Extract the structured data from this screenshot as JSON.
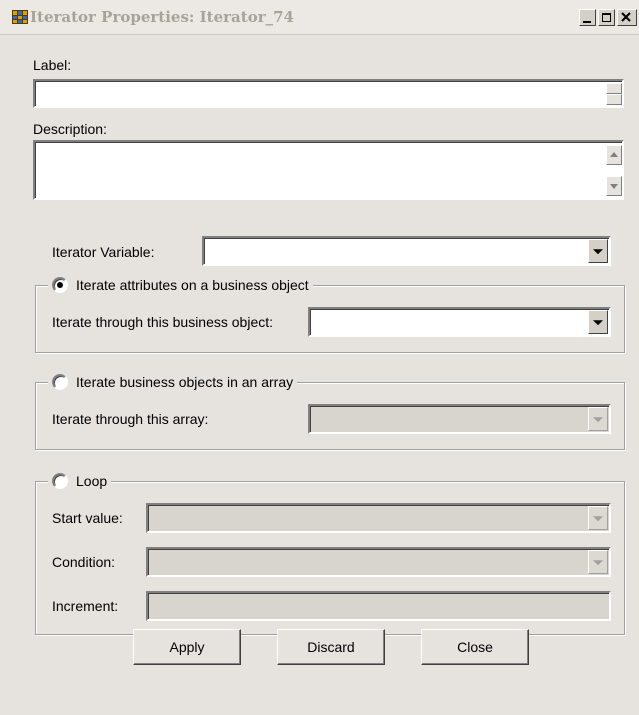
{
  "window": {
    "title": "Iterator Properties: Iterator_74"
  },
  "fields": {
    "label": {
      "label": "Label:",
      "value": ""
    },
    "description": {
      "label": "Description:",
      "value": ""
    },
    "iterator_variable": {
      "label": "Iterator Variable:",
      "value": ""
    }
  },
  "groups": {
    "business_object": {
      "label": "Iterate attributes on a business object",
      "selected": true,
      "field_label": "Iterate through this business object:",
      "value": ""
    },
    "array": {
      "label": "Iterate business objects in an array",
      "selected": false,
      "field_label": "Iterate through this array:",
      "value": ""
    },
    "loop": {
      "label": "Loop",
      "selected": false,
      "start_label": "Start value:",
      "condition_label": "Condition:",
      "increment_label": "Increment:"
    }
  },
  "buttons": {
    "apply": "Apply",
    "discard": "Discard",
    "close": "Close"
  },
  "icons": {
    "app": "iterator-app-icon",
    "minimize": "minimize-icon",
    "maximize": "maximize-icon",
    "close": "close-icon"
  }
}
